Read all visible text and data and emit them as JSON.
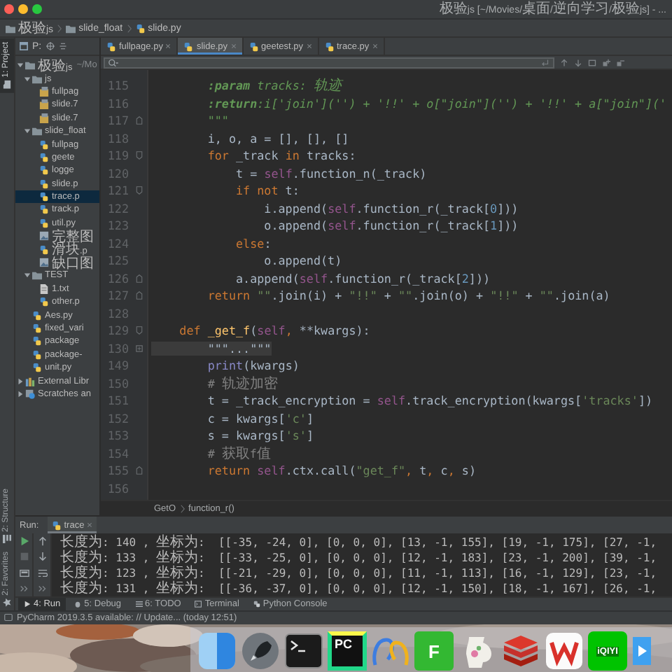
{
  "window": {
    "title": "极验js [~/Movies/桌面/逆向学习/极验js] - ..."
  },
  "navigation_bar": {
    "crumbs": [
      {
        "kind": "folder",
        "label": "极验js"
      },
      {
        "kind": "folder",
        "label": "slide_float"
      },
      {
        "kind": "py",
        "label": "slide.py"
      }
    ]
  },
  "tool_strip": [
    {
      "kind": "folder",
      "label": "1: Project",
      "selected": true
    },
    {
      "kind": "structure",
      "label": "2: Structure",
      "selected": false
    },
    {
      "kind": "star",
      "label": "2: Favorites",
      "selected": false
    }
  ],
  "project": {
    "toolbar_label": "P:",
    "tree": [
      {
        "kind": "folder",
        "label": "极验js",
        "note": "~/Mo",
        "expanded": true,
        "selected": false,
        "children": [
          {
            "kind": "folder",
            "label": "js",
            "expanded": true,
            "selected": false,
            "children": [
              {
                "kind": "js",
                "label": "fullpag",
                "selected": false
              },
              {
                "kind": "js",
                "label": "slide.7",
                "selected": false
              },
              {
                "kind": "js",
                "label": "slide.7",
                "selected": false
              }
            ]
          },
          {
            "kind": "folder",
            "label": "slide_float",
            "expanded": true,
            "selected": false,
            "children": [
              {
                "kind": "py",
                "label": "fullpag",
                "selected": false
              },
              {
                "kind": "py",
                "label": "geete",
                "selected": false
              },
              {
                "kind": "py",
                "label": "logge",
                "selected": false
              },
              {
                "kind": "py",
                "label": "slide.p",
                "selected": false
              },
              {
                "kind": "py",
                "label": "trace.p",
                "selected": true
              },
              {
                "kind": "py",
                "label": "track.p",
                "selected": false
              },
              {
                "kind": "py",
                "label": "util.py",
                "selected": false
              },
              {
                "kind": "img",
                "label": "完整图",
                "selected": false
              },
              {
                "kind": "py",
                "label": "滑块.p",
                "selected": false
              },
              {
                "kind": "img",
                "label": "缺口图",
                "selected": false
              }
            ]
          },
          {
            "kind": "folder",
            "label": "TEST",
            "expanded": true,
            "selected": false,
            "children": [
              {
                "kind": "txt",
                "label": "1.txt",
                "selected": false
              },
              {
                "kind": "py",
                "label": "other.p",
                "selected": false
              }
            ]
          },
          {
            "kind": "py",
            "label": "Aes.py",
            "selected": false
          },
          {
            "kind": "py",
            "label": "fixed_vari",
            "selected": false
          },
          {
            "kind": "py",
            "label": "package",
            "selected": false
          },
          {
            "kind": "py",
            "label": "package-",
            "selected": false
          },
          {
            "kind": "py",
            "label": "unit.py",
            "selected": false
          }
        ]
      },
      {
        "kind": "lib",
        "label": "External Libr",
        "expanded": false,
        "selected": false
      },
      {
        "kind": "scratch",
        "label": "Scratches an",
        "expanded": false,
        "selected": false
      }
    ]
  },
  "editor": {
    "tabs": [
      {
        "label": "fullpage.py",
        "selected": false
      },
      {
        "label": "slide.py",
        "selected": true
      },
      {
        "label": "geetest.py",
        "selected": false
      },
      {
        "label": "trace.py",
        "selected": false
      }
    ],
    "lines": [
      {
        "number": "115",
        "kind": "plain",
        "tokens": [
          {
            "kind": "doctag",
            "text": "        :param"
          },
          {
            "kind": "doc",
            "text": " tracks: 轨迹"
          }
        ]
      },
      {
        "number": "116",
        "kind": "plain",
        "tokens": [
          {
            "kind": "doctag",
            "text": "        :return"
          },
          {
            "kind": "doc",
            "text": ":i['join']('') + '!!' + o[\"join\"]('') + '!!' + a[\"join\"]('"
          }
        ]
      },
      {
        "number": "117",
        "kind": "fold_end",
        "tokens": [
          {
            "kind": "doc",
            "text": "        \"\"\""
          }
        ]
      },
      {
        "number": "118",
        "kind": "plain",
        "tokens": [
          {
            "kind": "plain",
            "text": "        i, o, a = [], [], []"
          }
        ]
      },
      {
        "number": "119",
        "kind": "fold_start",
        "tokens": [
          {
            "kind": "kw",
            "text": "        for"
          },
          {
            "kind": "plain",
            "text": " _track "
          },
          {
            "kind": "kw",
            "text": "in"
          },
          {
            "kind": "plain",
            "text": " tracks:"
          }
        ]
      },
      {
        "number": "120",
        "kind": "plain",
        "tokens": [
          {
            "kind": "plain",
            "text": "            t = "
          },
          {
            "kind": "self",
            "text": "self"
          },
          {
            "kind": "plain",
            "text": ".function_n(_track)"
          }
        ]
      },
      {
        "number": "121",
        "kind": "fold_start",
        "tokens": [
          {
            "kind": "kw",
            "text": "            if not"
          },
          {
            "kind": "plain",
            "text": " t:"
          }
        ]
      },
      {
        "number": "122",
        "kind": "plain",
        "tokens": [
          {
            "kind": "plain",
            "text": "                i.append("
          },
          {
            "kind": "self",
            "text": "self"
          },
          {
            "kind": "plain",
            "text": ".function_r(_track["
          },
          {
            "kind": "num",
            "text": "0"
          },
          {
            "kind": "plain",
            "text": "]))"
          }
        ]
      },
      {
        "number": "123",
        "kind": "plain",
        "tokens": [
          {
            "kind": "plain",
            "text": "                o.append("
          },
          {
            "kind": "self",
            "text": "self"
          },
          {
            "kind": "plain",
            "text": ".function_r(_track["
          },
          {
            "kind": "num",
            "text": "1"
          },
          {
            "kind": "plain",
            "text": "]))"
          }
        ]
      },
      {
        "number": "124",
        "kind": "plain",
        "tokens": [
          {
            "kind": "kw",
            "text": "            else"
          },
          {
            "kind": "plain",
            "text": ":"
          }
        ]
      },
      {
        "number": "125",
        "kind": "plain",
        "tokens": [
          {
            "kind": "plain",
            "text": "                o.append(t)"
          }
        ]
      },
      {
        "number": "126",
        "kind": "fold_end",
        "tokens": [
          {
            "kind": "plain",
            "text": "            a.append("
          },
          {
            "kind": "self",
            "text": "self"
          },
          {
            "kind": "plain",
            "text": ".function_r(_track["
          },
          {
            "kind": "num",
            "text": "2"
          },
          {
            "kind": "plain",
            "text": "]))"
          }
        ]
      },
      {
        "number": "127",
        "kind": "fold_end",
        "tokens": [
          {
            "kind": "kw",
            "text": "        return "
          },
          {
            "kind": "str",
            "text": "\"\""
          },
          {
            "kind": "plain",
            "text": ".join(i) + "
          },
          {
            "kind": "str",
            "text": "\"!!\""
          },
          {
            "kind": "plain",
            "text": " + "
          },
          {
            "kind": "str",
            "text": "\"\""
          },
          {
            "kind": "plain",
            "text": ".join(o) + "
          },
          {
            "kind": "str",
            "text": "\"!!\""
          },
          {
            "kind": "plain",
            "text": " + "
          },
          {
            "kind": "str",
            "text": "\"\""
          },
          {
            "kind": "plain",
            "text": ".join(a)"
          }
        ]
      },
      {
        "number": "128",
        "kind": "plain"
      },
      {
        "number": "129",
        "kind": "fold_start",
        "tokens": [
          {
            "kind": "kw",
            "text": "    def "
          },
          {
            "kind": "fn",
            "text": "_get_f"
          },
          {
            "kind": "plain",
            "text": "("
          },
          {
            "kind": "self",
            "text": "self"
          },
          {
            "kind": "kw",
            "text": ","
          },
          {
            "kind": "plain",
            "text": " **kwargs):"
          }
        ]
      },
      {
        "number": "130",
        "kind": "folded",
        "tokens": [
          {
            "kind": "folded",
            "text": "        \"\"\"...\"\"\""
          }
        ]
      },
      {
        "number": "149",
        "kind": "plain",
        "tokens": [
          {
            "kind": "builtin",
            "text": "        print"
          },
          {
            "kind": "plain",
            "text": "(kwargs)"
          }
        ]
      },
      {
        "number": "150",
        "kind": "plain",
        "tokens": [
          {
            "kind": "cmt",
            "text": "        # 轨迹加密"
          }
        ]
      },
      {
        "number": "151",
        "kind": "plain",
        "tokens": [
          {
            "kind": "plain",
            "text": "        t = _track_encryption = "
          },
          {
            "kind": "self",
            "text": "self"
          },
          {
            "kind": "plain",
            "text": ".track_encryption(kwargs["
          },
          {
            "kind": "str",
            "text": "'tracks'"
          },
          {
            "kind": "plain",
            "text": "])"
          }
        ]
      },
      {
        "number": "152",
        "kind": "plain",
        "tokens": [
          {
            "kind": "plain",
            "text": "        c = kwargs["
          },
          {
            "kind": "str",
            "text": "'c'"
          },
          {
            "kind": "plain",
            "text": "]"
          }
        ]
      },
      {
        "number": "153",
        "kind": "plain",
        "tokens": [
          {
            "kind": "plain",
            "text": "        s = kwargs["
          },
          {
            "kind": "str",
            "text": "'s'"
          },
          {
            "kind": "plain",
            "text": "]"
          }
        ]
      },
      {
        "number": "154",
        "kind": "plain",
        "tokens": [
          {
            "kind": "cmt",
            "text": "        # 获取f值"
          }
        ]
      },
      {
        "number": "155",
        "kind": "fold_end",
        "tokens": [
          {
            "kind": "kw",
            "text": "        return "
          },
          {
            "kind": "self",
            "text": "self"
          },
          {
            "kind": "plain",
            "text": ".ctx.call("
          },
          {
            "kind": "str",
            "text": "\"get_f\""
          },
          {
            "kind": "kw",
            "text": ","
          },
          {
            "kind": "plain",
            "text": " t"
          },
          {
            "kind": "kw",
            "text": ","
          },
          {
            "kind": "plain",
            "text": " c"
          },
          {
            "kind": "kw",
            "text": ","
          },
          {
            "kind": "plain",
            "text": " s)"
          }
        ]
      },
      {
        "number": "156",
        "kind": "plain"
      }
    ],
    "breadcrumb": [
      "GetO",
      "function_r()"
    ]
  },
  "run": {
    "label": "Run:",
    "tab": "trace",
    "output": [
      "长度为: 140 , 坐标为:  [[-35, -24, 0], [0, 0, 0], [13, -1, 155], [19, -1, 175], [27, -1,",
      "长度为: 133 , 坐标为:  [[-33, -25, 0], [0, 0, 0], [12, -1, 183], [23, -1, 200], [39, -1,",
      "长度为: 123 , 坐标为:  [[-21, -29, 0], [0, 0, 0], [11, -1, 113], [16, -1, 129], [23, -1,",
      "长度为: 131 , 坐标为:  [[-36, -37, 0], [0, 0, 0], [12, -1, 150], [18, -1, 167], [26, -1,"
    ]
  },
  "tool_tabs": [
    {
      "kind": "run",
      "label": "4: Run",
      "selected": true
    },
    {
      "kind": "debug",
      "label": "5: Debug",
      "selected": false
    },
    {
      "kind": "todo",
      "label": "6: TODO",
      "selected": false
    },
    {
      "kind": "terminal",
      "label": "Terminal",
      "selected": false
    },
    {
      "kind": "console",
      "label": "Python Console",
      "selected": false
    }
  ],
  "status_bar": {
    "text": "PyCharm 2019.3.5 available: // Update... (today 12:51)"
  },
  "dock": [
    {
      "kind": "finder"
    },
    {
      "kind": "rocket"
    },
    {
      "kind": "terminal"
    },
    {
      "kind": "pycharm",
      "label": "PC"
    },
    {
      "kind": "loops"
    },
    {
      "kind": "letter",
      "label": "F"
    },
    {
      "kind": "jug"
    },
    {
      "kind": "redis"
    },
    {
      "kind": "wps"
    },
    {
      "kind": "iqiyi",
      "label": "iQIYI"
    },
    {
      "kind": "video"
    }
  ]
}
